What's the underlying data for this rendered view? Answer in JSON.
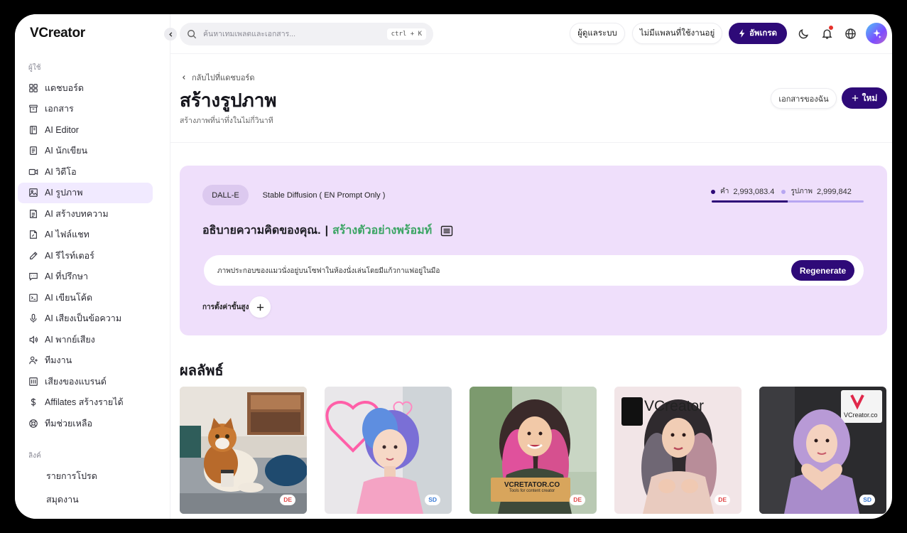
{
  "app": {
    "logo": "VCreator"
  },
  "sidebar": {
    "section_user": "ผู้ใช้",
    "items": [
      {
        "label": "แดชบอร์ด",
        "icon": "grid-icon"
      },
      {
        "label": "เอกสาร",
        "icon": "archive-icon"
      },
      {
        "label": "AI Editor",
        "icon": "book-icon"
      },
      {
        "label": "AI นักเขียน",
        "icon": "document-icon"
      },
      {
        "label": "AI วิดีโอ",
        "icon": "video-icon"
      },
      {
        "label": "AI รูปภาพ",
        "icon": "image-icon",
        "active": true
      },
      {
        "label": "AI สร้างบทความ",
        "icon": "article-icon"
      },
      {
        "label": "AI ไฟล์แชท",
        "icon": "file-chat-icon"
      },
      {
        "label": "AI รีไรท์เตอร์",
        "icon": "pen-icon"
      },
      {
        "label": "AI ที่ปรึกษา",
        "icon": "chat-icon"
      },
      {
        "label": "AI เขียนโค้ด",
        "icon": "terminal-icon"
      },
      {
        "label": "AI เสียงเป็นข้อความ",
        "icon": "microphone-icon"
      },
      {
        "label": "AI พากย์เสียง",
        "icon": "speaker-icon"
      },
      {
        "label": "ทีมงาน",
        "icon": "user-plus-icon"
      },
      {
        "label": "เสียงของแบรนด์",
        "icon": "brand-icon"
      },
      {
        "label": "Affilates สร้างรายได้",
        "icon": "dollar-icon"
      },
      {
        "label": "ทีมช่วยเหลือ",
        "icon": "lifebuoy-icon"
      }
    ],
    "section_links": "ลิงค์",
    "links": [
      "รายการโปรด",
      "สมุดงาน"
    ]
  },
  "header": {
    "search_placeholder": "ค้นหาเทมเพลตและเอกสาร...",
    "search_shortcut": "ctrl + K",
    "admin_label": "ผู้ดูแลระบบ",
    "plan_label": "ไม่มีแพลนที่ใช้งานอยู่",
    "upgrade_label": "อัพเกรด"
  },
  "page": {
    "back_label": "กลับไปที่แดชบอร์ด",
    "title": "สร้างรูปภาพ",
    "subtitle": "สร้างภาพที่น่าทึ่งในไม่กี่วินาที",
    "my_docs_label": "เอกสารของฉัน",
    "new_label": "ใหม่"
  },
  "generator": {
    "models": [
      "DALL-E",
      "Stable Diffusion ( EN Prompt Only )"
    ],
    "credits": {
      "words_label": "คำ",
      "words_value": "2,993,083.4",
      "images_label": "รูปภาพ",
      "images_value": "2,999,842",
      "words_fraction": 0.5,
      "words_color": "#2e0a78",
      "images_color": "#b7a6f1"
    },
    "prompt_title": "อธิบายความคิดของคุณ.",
    "prompt_separator": "|",
    "prompt_example_link": "สร้างตัวอย่างพร้อมท์",
    "prompt_value": "ภาพประกอบของแมวนั่งอยู่บนโซฟาในห้องนั่งเล่นโดยมีแก้วกาแฟอยู่ในมือ",
    "regenerate_label": "Regenerate",
    "advanced_label": "การตั้งค่าขั้นสูง"
  },
  "results": {
    "title": "ผลลัพธ์",
    "images": [
      {
        "badge": "DE",
        "subject": "cat-on-sofa"
      },
      {
        "badge": "SD",
        "subject": "woman-neon-sign"
      },
      {
        "badge": "DE",
        "subject": "woman-vcretator-sign",
        "sign_text": "VCRETATOR.CO",
        "sign_sub": "Tools for content creator"
      },
      {
        "badge": "DE",
        "subject": "woman-vcreator-wall",
        "wall_text": "VCreator"
      },
      {
        "badge": "SD",
        "subject": "woman-heart-hands",
        "sign_text": "VCreator.co"
      }
    ]
  },
  "colors": {
    "accent": "#2e0a78",
    "panel": "#efdffb",
    "active_nav": "#f1eaff",
    "green": "#3aa463"
  }
}
